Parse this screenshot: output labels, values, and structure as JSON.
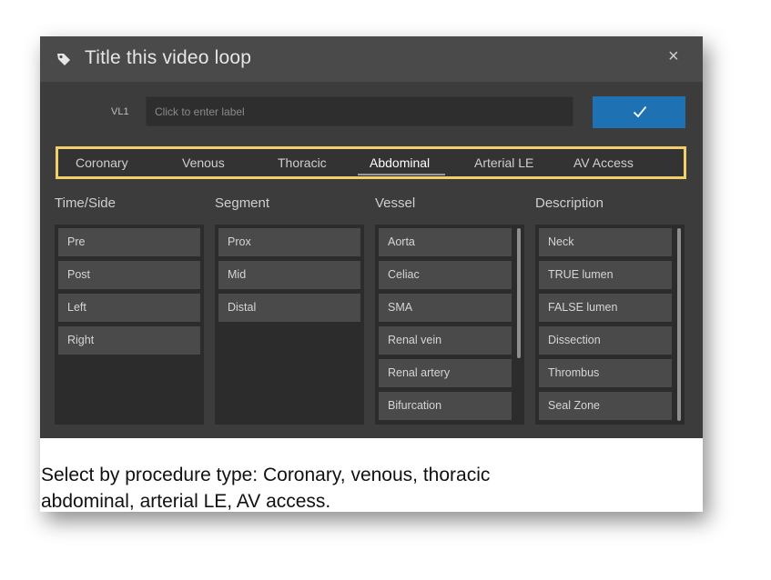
{
  "dialog": {
    "title": "Title this video loop",
    "icons": {
      "title": "tag-icon",
      "close": "close-icon",
      "confirm": "check-icon"
    },
    "close_symbol": "×"
  },
  "label_row": {
    "vl_label": "VL1",
    "placeholder": "Click to enter label"
  },
  "tabs": [
    {
      "label": "Coronary"
    },
    {
      "label": "Venous"
    },
    {
      "label": "Thoracic"
    },
    {
      "label": "Abdominal",
      "selected": true
    },
    {
      "label": "Arterial LE"
    },
    {
      "label": "AV Access"
    }
  ],
  "columns": [
    {
      "heading": "Time/Side",
      "items": [
        "Pre",
        "Post",
        "Left",
        "Right"
      ]
    },
    {
      "heading": "Segment",
      "items": [
        "Prox",
        "Mid",
        "Distal"
      ]
    },
    {
      "heading": "Vessel",
      "items": [
        "Aorta",
        "Celiac",
        "SMA",
        "Renal vein",
        "Renal artery",
        "Bifurcation"
      ]
    },
    {
      "heading": "Description",
      "items": [
        "Neck",
        "TRUE lumen",
        "FALSE lumen",
        "Dissection",
        "Thrombus",
        "Seal Zone"
      ]
    }
  ],
  "caption": {
    "line1": "Select by procedure type: Coronary, venous, thoracic",
    "line2": "abdominal, arterial LE, AV access."
  },
  "colors": {
    "dialog_bg": "#3c3c3c",
    "titlebar_bg": "#4a4a4a",
    "confirm_button": "#1e72b3",
    "tab_highlight_border": "#f2cf6b",
    "item_bg": "#4a4a4a"
  }
}
